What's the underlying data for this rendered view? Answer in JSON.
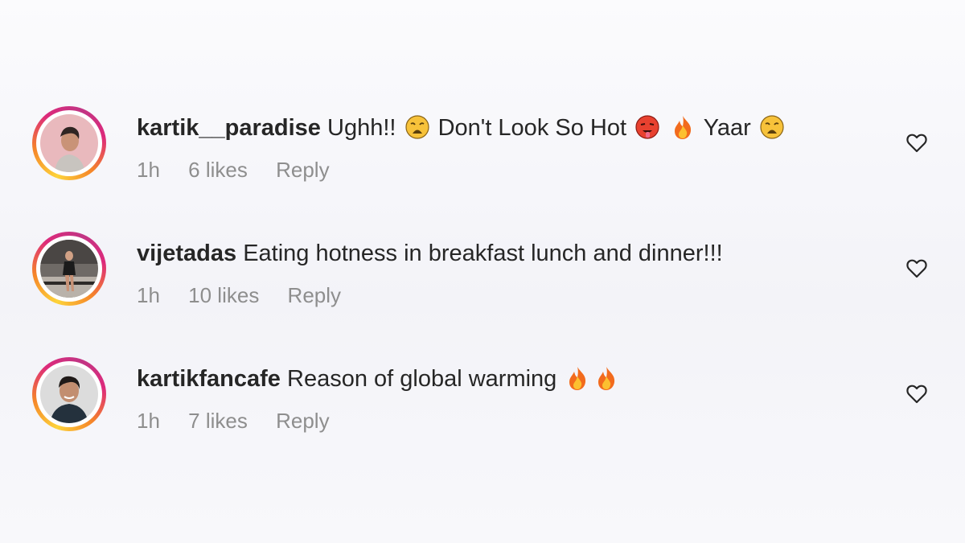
{
  "comments": [
    {
      "username": "kartik__paradise",
      "parts": [
        "Ughh!!",
        "Don't Look So Hot",
        "Yaar"
      ],
      "emojis": [
        "weary-face-emoji",
        "hot-face-emoji",
        "fire-emoji",
        "weary-face-emoji"
      ],
      "time": "1h",
      "likes": "6 likes",
      "reply": "Reply"
    },
    {
      "username": "vijetadas",
      "text": "Eating hotness in breakfast lunch and dinner!!!",
      "time": "1h",
      "likes": "10 likes",
      "reply": "Reply"
    },
    {
      "username": "kartikfancafe",
      "text": "Reason of global warming",
      "emojis": [
        "fire-emoji",
        "fire-emoji"
      ],
      "time": "1h",
      "likes": "7 likes",
      "reply": "Reply"
    }
  ],
  "colors": {
    "text": "#262626",
    "meta": "#8e8e8e",
    "ring_gradient": [
      "#fdd33a",
      "#f58529",
      "#dd2a7b",
      "#c13584"
    ]
  }
}
